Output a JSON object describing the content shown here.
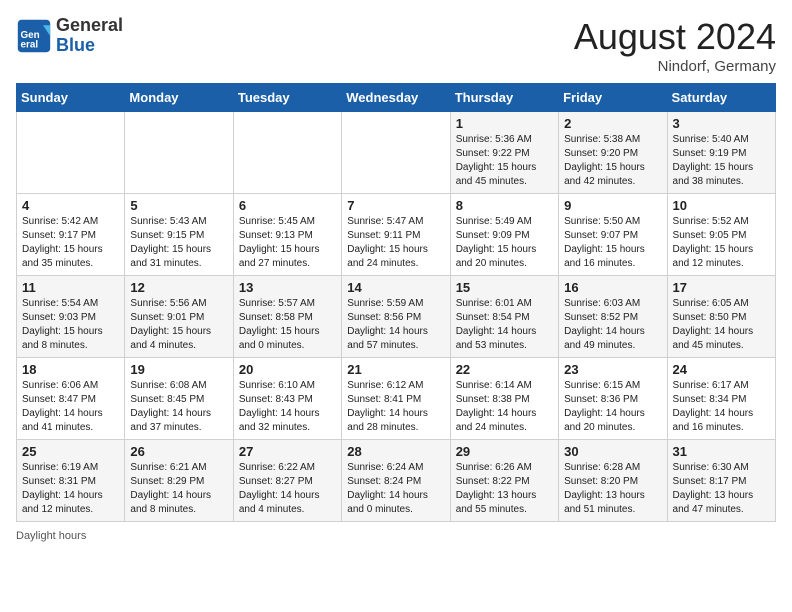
{
  "header": {
    "logo_text_general": "General",
    "logo_text_blue": "Blue",
    "month_year": "August 2024",
    "location": "Nindorf, Germany"
  },
  "days_of_week": [
    "Sunday",
    "Monday",
    "Tuesday",
    "Wednesday",
    "Thursday",
    "Friday",
    "Saturday"
  ],
  "weeks": [
    [
      {
        "day": "",
        "info": ""
      },
      {
        "day": "",
        "info": ""
      },
      {
        "day": "",
        "info": ""
      },
      {
        "day": "",
        "info": ""
      },
      {
        "day": "1",
        "info": "Sunrise: 5:36 AM\nSunset: 9:22 PM\nDaylight: 15 hours\nand 45 minutes."
      },
      {
        "day": "2",
        "info": "Sunrise: 5:38 AM\nSunset: 9:20 PM\nDaylight: 15 hours\nand 42 minutes."
      },
      {
        "day": "3",
        "info": "Sunrise: 5:40 AM\nSunset: 9:19 PM\nDaylight: 15 hours\nand 38 minutes."
      }
    ],
    [
      {
        "day": "4",
        "info": "Sunrise: 5:42 AM\nSunset: 9:17 PM\nDaylight: 15 hours\nand 35 minutes."
      },
      {
        "day": "5",
        "info": "Sunrise: 5:43 AM\nSunset: 9:15 PM\nDaylight: 15 hours\nand 31 minutes."
      },
      {
        "day": "6",
        "info": "Sunrise: 5:45 AM\nSunset: 9:13 PM\nDaylight: 15 hours\nand 27 minutes."
      },
      {
        "day": "7",
        "info": "Sunrise: 5:47 AM\nSunset: 9:11 PM\nDaylight: 15 hours\nand 24 minutes."
      },
      {
        "day": "8",
        "info": "Sunrise: 5:49 AM\nSunset: 9:09 PM\nDaylight: 15 hours\nand 20 minutes."
      },
      {
        "day": "9",
        "info": "Sunrise: 5:50 AM\nSunset: 9:07 PM\nDaylight: 15 hours\nand 16 minutes."
      },
      {
        "day": "10",
        "info": "Sunrise: 5:52 AM\nSunset: 9:05 PM\nDaylight: 15 hours\nand 12 minutes."
      }
    ],
    [
      {
        "day": "11",
        "info": "Sunrise: 5:54 AM\nSunset: 9:03 PM\nDaylight: 15 hours\nand 8 minutes."
      },
      {
        "day": "12",
        "info": "Sunrise: 5:56 AM\nSunset: 9:01 PM\nDaylight: 15 hours\nand 4 minutes."
      },
      {
        "day": "13",
        "info": "Sunrise: 5:57 AM\nSunset: 8:58 PM\nDaylight: 15 hours\nand 0 minutes."
      },
      {
        "day": "14",
        "info": "Sunrise: 5:59 AM\nSunset: 8:56 PM\nDaylight: 14 hours\nand 57 minutes."
      },
      {
        "day": "15",
        "info": "Sunrise: 6:01 AM\nSunset: 8:54 PM\nDaylight: 14 hours\nand 53 minutes."
      },
      {
        "day": "16",
        "info": "Sunrise: 6:03 AM\nSunset: 8:52 PM\nDaylight: 14 hours\nand 49 minutes."
      },
      {
        "day": "17",
        "info": "Sunrise: 6:05 AM\nSunset: 8:50 PM\nDaylight: 14 hours\nand 45 minutes."
      }
    ],
    [
      {
        "day": "18",
        "info": "Sunrise: 6:06 AM\nSunset: 8:47 PM\nDaylight: 14 hours\nand 41 minutes."
      },
      {
        "day": "19",
        "info": "Sunrise: 6:08 AM\nSunset: 8:45 PM\nDaylight: 14 hours\nand 37 minutes."
      },
      {
        "day": "20",
        "info": "Sunrise: 6:10 AM\nSunset: 8:43 PM\nDaylight: 14 hours\nand 32 minutes."
      },
      {
        "day": "21",
        "info": "Sunrise: 6:12 AM\nSunset: 8:41 PM\nDaylight: 14 hours\nand 28 minutes."
      },
      {
        "day": "22",
        "info": "Sunrise: 6:14 AM\nSunset: 8:38 PM\nDaylight: 14 hours\nand 24 minutes."
      },
      {
        "day": "23",
        "info": "Sunrise: 6:15 AM\nSunset: 8:36 PM\nDaylight: 14 hours\nand 20 minutes."
      },
      {
        "day": "24",
        "info": "Sunrise: 6:17 AM\nSunset: 8:34 PM\nDaylight: 14 hours\nand 16 minutes."
      }
    ],
    [
      {
        "day": "25",
        "info": "Sunrise: 6:19 AM\nSunset: 8:31 PM\nDaylight: 14 hours\nand 12 minutes."
      },
      {
        "day": "26",
        "info": "Sunrise: 6:21 AM\nSunset: 8:29 PM\nDaylight: 14 hours\nand 8 minutes."
      },
      {
        "day": "27",
        "info": "Sunrise: 6:22 AM\nSunset: 8:27 PM\nDaylight: 14 hours\nand 4 minutes."
      },
      {
        "day": "28",
        "info": "Sunrise: 6:24 AM\nSunset: 8:24 PM\nDaylight: 14 hours\nand 0 minutes."
      },
      {
        "day": "29",
        "info": "Sunrise: 6:26 AM\nSunset: 8:22 PM\nDaylight: 13 hours\nand 55 minutes."
      },
      {
        "day": "30",
        "info": "Sunrise: 6:28 AM\nSunset: 8:20 PM\nDaylight: 13 hours\nand 51 minutes."
      },
      {
        "day": "31",
        "info": "Sunrise: 6:30 AM\nSunset: 8:17 PM\nDaylight: 13 hours\nand 47 minutes."
      }
    ]
  ],
  "footer": {
    "daylight_label": "Daylight hours"
  }
}
